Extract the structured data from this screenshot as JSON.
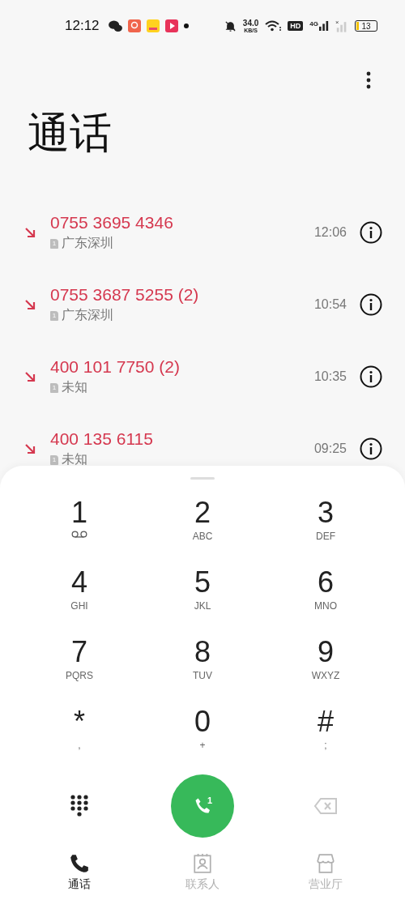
{
  "status_bar": {
    "time": "12:12",
    "speed": "34.0",
    "speed_unit": "KB/S",
    "hd": "HD",
    "network": "4G",
    "battery": "13"
  },
  "title": "通话",
  "calls": [
    {
      "kind": "missed",
      "number": "0755 3695 4346",
      "sim": "1",
      "location": "广东深圳",
      "time": "12:06"
    },
    {
      "kind": "missed",
      "number": "0755 3687 5255 (2)",
      "sim": "1",
      "location": "广东深圳",
      "time": "10:54"
    },
    {
      "kind": "missed",
      "number": "400 101 7750 (2)",
      "sim": "1",
      "location": "未知",
      "time": "10:35"
    },
    {
      "kind": "missed",
      "number": "400 135 6115",
      "sim": "1",
      "location": "未知",
      "time": "09:25"
    }
  ],
  "dialpad": {
    "keys": [
      {
        "digit": "1",
        "kind": "voicemail"
      },
      {
        "digit": "2",
        "kind": "text",
        "sub": "ABC"
      },
      {
        "digit": "3",
        "kind": "text",
        "sub": "DEF"
      },
      {
        "digit": "4",
        "kind": "text",
        "sub": "GHI"
      },
      {
        "digit": "5",
        "kind": "text",
        "sub": "JKL"
      },
      {
        "digit": "6",
        "kind": "text",
        "sub": "MNO"
      },
      {
        "digit": "7",
        "kind": "text",
        "sub": "PQRS"
      },
      {
        "digit": "8",
        "kind": "text",
        "sub": "TUV"
      },
      {
        "digit": "9",
        "kind": "text",
        "sub": "WXYZ"
      },
      {
        "digit": "*",
        "kind": "text",
        "sub": ","
      },
      {
        "digit": "0",
        "kind": "text",
        "sub": "+"
      },
      {
        "digit": "#",
        "kind": "text",
        "sub": ";"
      }
    ],
    "call_sim": "1"
  },
  "tabs": [
    {
      "label": "通话",
      "kind": "phone",
      "selected": true
    },
    {
      "label": "联系人",
      "kind": "contact",
      "selected": false
    },
    {
      "label": "营业厅",
      "kind": "store",
      "selected": false
    }
  ]
}
